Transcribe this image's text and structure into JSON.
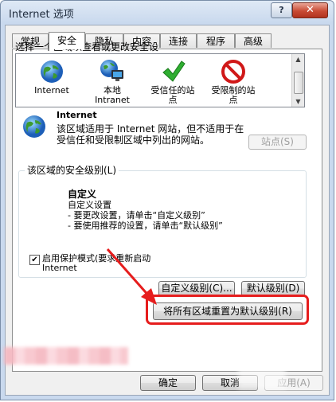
{
  "window": {
    "title": "Internet 选项",
    "help_label": "?",
    "close_label": "✕"
  },
  "tabs": [
    {
      "label": "常规"
    },
    {
      "label": "安全"
    },
    {
      "label": "隐私"
    },
    {
      "label": "内容"
    },
    {
      "label": "连接"
    },
    {
      "label": "程序"
    },
    {
      "label": "高级"
    }
  ],
  "active_tab": "安全",
  "zones": {
    "prompt": "选择一个区域以查看或更改安全设",
    "items": [
      {
        "label": "Internet",
        "icon": "globe-icon"
      },
      {
        "label": "本地\nIntranet",
        "icon": "intranet-icon"
      },
      {
        "label": "受信任的站\n点",
        "icon": "checkmark-icon"
      },
      {
        "label": "受限制的站\n点",
        "icon": "restricted-icon"
      }
    ],
    "selected": "Internet"
  },
  "zone_info": {
    "title": "Internet",
    "description": "该区域适用于 Internet 网站，但不适用于在受信任和受限制区域中列出的网站。",
    "sites_button": "站点(S)"
  },
  "security_level": {
    "legend": "该区域的安全级别(L)",
    "level_name": "自定义",
    "description": "自定义设置\n- 要更改设置，请单击“自定义级别”\n- 要使用推荐的设置，请单击“默认级别”",
    "protected_mode_label": "启用保护模式(要求重新启动 Internet",
    "protected_mode_checked": true,
    "custom_level_button": "自定义级别(C)...",
    "default_level_button": "默认级别(D)",
    "reset_all_button": "将所有区域重置为默认级别(R)"
  },
  "footer": {
    "ok_button": "确定",
    "cancel_button": "取消",
    "apply_button": "应用(A)"
  },
  "colors": {
    "highlight": "#e61d1d",
    "accent": "#2f7fd3"
  }
}
